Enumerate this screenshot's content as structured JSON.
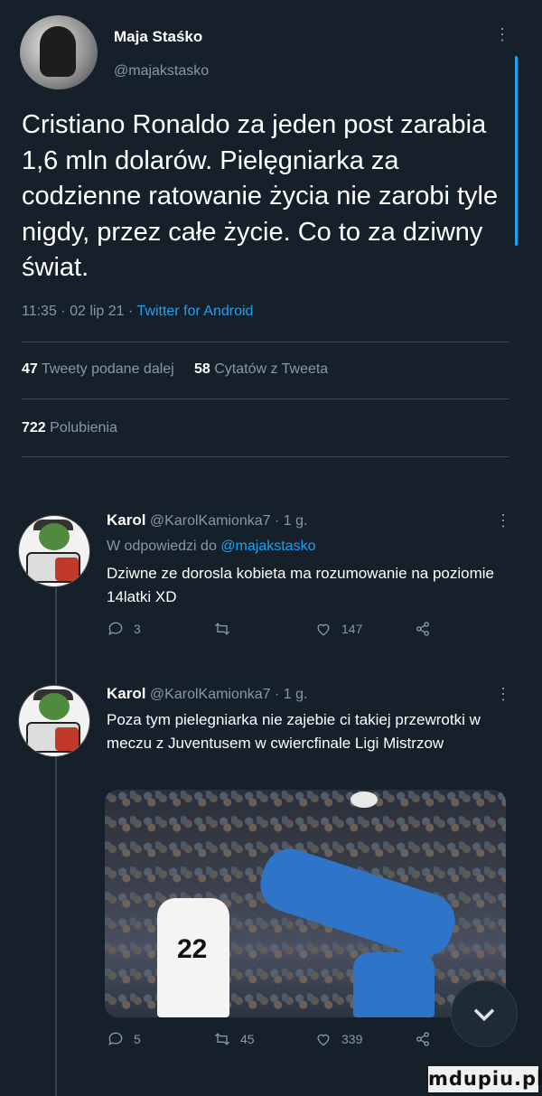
{
  "main_tweet": {
    "author_name": "Maja Staśko",
    "author_handle": "@majakstasko",
    "text": "Cristiano Ronaldo za jeden post zarabia 1,6 mln dolarów. Pielęgniarka za codzienne ratowanie życia nie zarobi tyle nigdy, przez całe życie. Co to za dziwny świat.",
    "time_date": "11:35 · 02 lip 21 · ",
    "source": "Twitter for Android",
    "retweets_count": "47",
    "retweets_label": "Tweety podane dalej",
    "quotes_count": "58",
    "quotes_label": "Cytatów z Tweeta",
    "likes_count": "722",
    "likes_label": "Polubienia",
    "more_icon": "more-icon"
  },
  "replies": [
    {
      "name": "Karol",
      "handle_time": "@KarolKamionka7 · 1 g.",
      "reply_to_label": "W odpowiedzi do ",
      "reply_to_handle": "@majakstasko",
      "text": "Dziwne ze dorosla kobieta ma rozumowanie na poziomie 14latki XD",
      "reply_count": "3",
      "retweet_count": "",
      "like_count": "147"
    },
    {
      "name": "Karol",
      "handle_time": "@KarolKamionka7 · 1 g.",
      "text": "Poza tym pielegniarka nie zajebie ci takiej przewrotki w meczu z Juventusem w cwiercfinale Ligi Mistrzow",
      "reply_count": "5",
      "retweet_count": "45",
      "like_count": "339",
      "media_jersey_number": "22"
    }
  ],
  "watermark": "mdupiu.pl",
  "colors": {
    "background": "#15202b",
    "accent": "#1da1f2",
    "muted_text": "#8899a6",
    "divider": "#38444d"
  }
}
